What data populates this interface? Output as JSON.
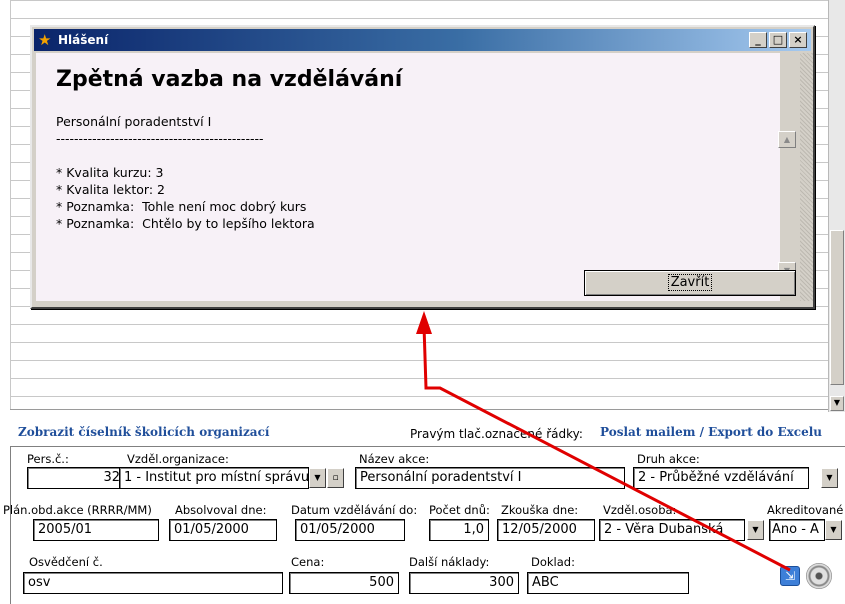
{
  "colors": {
    "accent_link": "#1f4e9a",
    "titlebar_start": "#0a246a",
    "arrow": "#e00000"
  },
  "dialog": {
    "title": "Hlášení",
    "title_icon": "app-icon",
    "heading": "Zpětná vazba na vzdělávání",
    "lines": [
      "Personální poradentství I",
      "----------------------------------------------",
      "",
      "* Kvalita kurzu: 3",
      "* Kvalita lektor: 2",
      "* Poznamka:  Tohle není moc dobrý kurs",
      "* Poznamka:  Chtělo by to lepšího lektora"
    ],
    "close_button": "Zavřít",
    "btn_min": "_",
    "btn_max": "□",
    "btn_close": "×"
  },
  "form": {
    "link_orgs": "Zobrazit číselník školicích organizací",
    "right_click_label": "Pravým tlač.označené řádky:",
    "link_mail": "Poslat mailem  / Export do Excelu",
    "labels": {
      "pers": "Pers.č.:",
      "org": "Vzděl.organizace:",
      "nazev": "Název akce:",
      "druh": "Druh akce:",
      "plan": "Plán.obd.akce (RRRR/MM)",
      "absolv": "Absolvoval dne:",
      "datum_do": "Datum vzdělávání do:",
      "pocet": "Počet dnů:",
      "zkouska": "Zkouška dne:",
      "osoba": "Vzděl.osoba:",
      "akred": "Akreditované",
      "osvedceni": "Osvědčení č.",
      "cena": "Cena:",
      "dalsi": "Další náklady:",
      "doklad": "Doklad:"
    },
    "values": {
      "pers": "32",
      "org": "1 - Institut pro místní správu",
      "nazev": "Personální poradentství I",
      "druh": "2 - Průběžné vzdělávání",
      "plan": "2005/01",
      "absolv": "01/05/2000",
      "datum_do": "01/05/2000",
      "pocet": "1,0",
      "zkouska": "12/05/2000",
      "osoba": "2 - Věra Dubanská",
      "akred": "Ano - A",
      "osvedceni": "osv",
      "cena": "500",
      "dalsi": "300",
      "doklad": "ABC"
    }
  },
  "icons": {
    "export": "export-icon",
    "disc": "disc-icon"
  }
}
